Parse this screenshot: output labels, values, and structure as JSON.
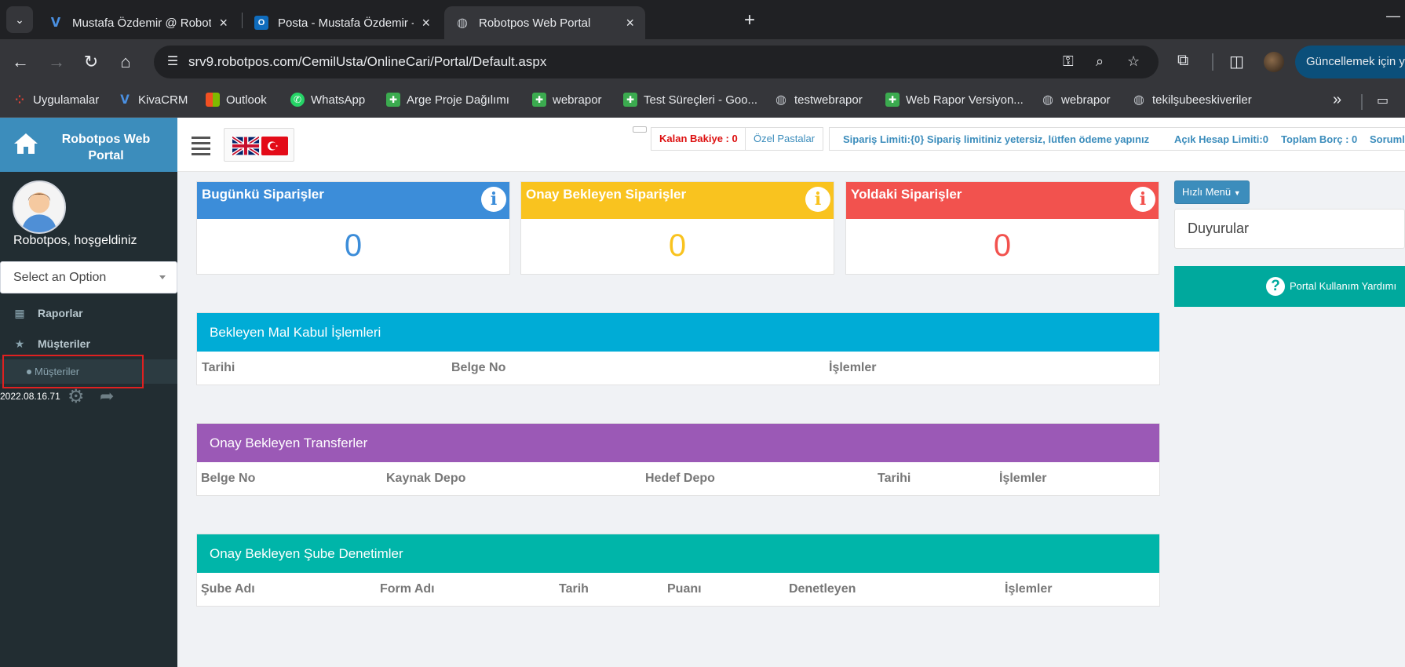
{
  "browser": {
    "tabs": [
      {
        "title": "Mustafa Özdemir @ Robotpos"
      },
      {
        "title": "Posta - Mustafa Özdemir - Outlook"
      },
      {
        "title": "Robotpos Web Portal"
      }
    ],
    "url": "srv9.robotpos.com/CemilUsta/OnlineCari/Portal/Default.aspx",
    "update_button": "Güncellemek için y",
    "bookmarks": [
      {
        "label": "Uygulamalar"
      },
      {
        "label": "KivaCRM"
      },
      {
        "label": "Outlook"
      },
      {
        "label": "WhatsApp"
      },
      {
        "label": "Arge Proje Dağılımı"
      },
      {
        "label": "webrapor"
      },
      {
        "label": "Test Süreçleri - Goo..."
      },
      {
        "label": "testwebrapor"
      },
      {
        "label": "Web Rapor Versiyon..."
      },
      {
        "label": "webrapor"
      },
      {
        "label": "tekilşubeeskiveriler"
      }
    ]
  },
  "sidebar": {
    "brand": "Robotpos Web Portal",
    "welcome": "Robotpos, hoşgeldiniz",
    "select_placeholder": "Select an Option",
    "menu": [
      {
        "label": "Raporlar",
        "icon": "table-icon"
      },
      {
        "label": "Müşteriler",
        "icon": "star-icon"
      }
    ],
    "submenu_item": "Müşteriler",
    "version": "2022.08.16.71"
  },
  "topnav": {
    "kalan_bakiye": "Kalan Bakiye : 0",
    "ozel_pastalar": "Özel Pastalar",
    "siparis_limiti": "Sipariş Limiti:{0} Sipariş limitiniz yetersiz, lütfen ödeme yapınız",
    "acik_hesap": "Açık Hesap Limiti:0",
    "toplam_borc": "Toplam Borç : 0",
    "sorumlu": "Sorumlu"
  },
  "stats": [
    {
      "title": "Bugünkü Siparişler",
      "value": "0",
      "color": "#3c8dd9"
    },
    {
      "title": "Onay Bekleyen Siparişler",
      "value": "0",
      "color": "#f9c31f"
    },
    {
      "title": "Yoldaki Siparişler",
      "value": "0",
      "color": "#f2524e"
    }
  ],
  "panels": [
    {
      "title": "Bekleyen Mal Kabul İşlemleri",
      "color": "#00acd6",
      "columns": [
        "Tarihi",
        "Belge No",
        "İşlemler"
      ]
    },
    {
      "title": "Onay Bekleyen Transferler",
      "color": "#9b59b6",
      "columns": [
        "Belge No",
        "Kaynak Depo",
        "Hedef Depo",
        "Tarihi",
        "İşlemler"
      ]
    },
    {
      "title": "Onay Bekleyen Şube Denetimler",
      "color": "#00b5a9",
      "columns": [
        "Şube Adı",
        "Form Adı",
        "Tarih",
        "Puanı",
        "Denetleyen",
        "İşlemler"
      ]
    }
  ],
  "right": {
    "quick_menu": "Hızlı Menü",
    "announcements": "Duyurular",
    "help": "Portal Kullanım Yardımı"
  }
}
